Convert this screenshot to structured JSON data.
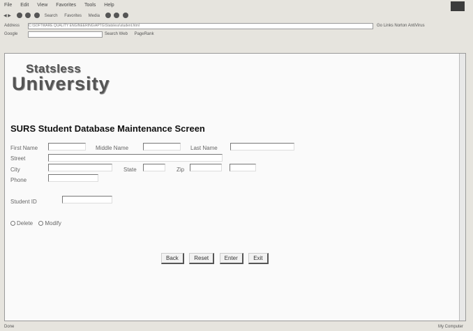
{
  "menubar": {
    "items": [
      "File",
      "Edit",
      "View",
      "Favorites",
      "Tools",
      "Help"
    ]
  },
  "toolbar": {
    "search_label": "Search",
    "favorites_label": "Favorites",
    "media_label": "Media"
  },
  "address": {
    "label": "Address",
    "value": "C:\\SOFTWARE QUALITY ENGINEERING\\APTG\\Statsless\\student.html",
    "go_label": "Go",
    "links_label": "Links",
    "extra_label": "Norton AntiVirus"
  },
  "googlebar": {
    "label": "Google",
    "search_web_label": "Search Web",
    "pagerank_label": "PageRank"
  },
  "logo": {
    "line1": "Statsless",
    "line2": "University"
  },
  "page": {
    "title": "SURS Student Database Maintenance Screen"
  },
  "form": {
    "first_name_label": "First Name",
    "middle_name_label": "Middle Name",
    "last_name_label": "Last Name",
    "street_label": "Street",
    "city_label": "City",
    "state_label": "State",
    "zip_label": "Zip",
    "phone_label": "Phone",
    "student_id_label": "Student ID",
    "radio_delete_label": "Delete",
    "radio_modify_label": "Modify"
  },
  "buttons": {
    "back": "Back",
    "reset": "Reset",
    "enter": "Enter",
    "exit": "Exit"
  },
  "status": {
    "left": "Done",
    "right": "My Computer"
  }
}
